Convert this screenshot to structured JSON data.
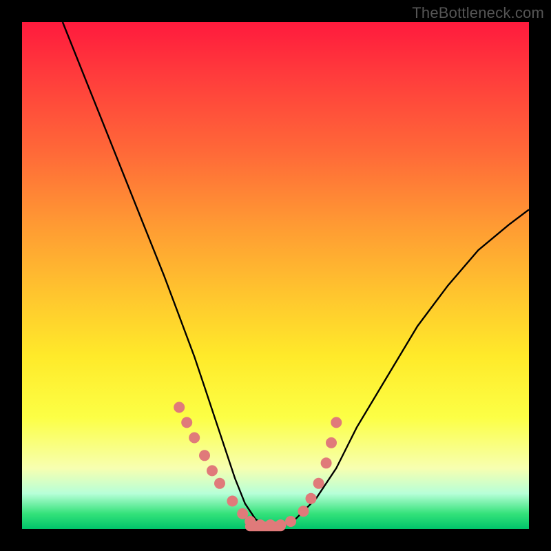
{
  "watermark": "TheBottleneck.com",
  "chart_data": {
    "type": "line",
    "title": "",
    "xlabel": "",
    "ylabel": "",
    "xlim": [
      0,
      100
    ],
    "ylim": [
      0,
      100
    ],
    "grid": false,
    "legend": false,
    "series": [
      {
        "name": "bottleneck-curve",
        "color": "#000000",
        "x": [
          8,
          12,
          16,
          20,
          24,
          28,
          31,
          34,
          36,
          38,
          40,
          42,
          44,
          46,
          48,
          51,
          54,
          58,
          62,
          66,
          72,
          78,
          84,
          90,
          96,
          100
        ],
        "y": [
          100,
          90,
          80,
          70,
          60,
          50,
          42,
          34,
          28,
          22,
          16,
          10,
          5,
          2,
          0.5,
          0.5,
          2,
          6,
          12,
          20,
          30,
          40,
          48,
          55,
          60,
          63
        ]
      },
      {
        "name": "marker-dots",
        "color": "#e07a7a",
        "type": "scatter",
        "x": [
          31.0,
          32.5,
          34.0,
          36.0,
          37.5,
          39.0,
          41.5,
          43.5,
          45.0,
          47.0,
          49.0,
          51.0,
          53.0,
          55.5,
          57.0,
          58.5,
          60.0,
          61.0,
          62.0
        ],
        "y": [
          24.0,
          21.0,
          18.0,
          14.5,
          11.5,
          9.0,
          5.5,
          3.0,
          1.5,
          0.8,
          0.8,
          0.8,
          1.5,
          3.5,
          6.0,
          9.0,
          13.0,
          17.0,
          21.0
        ]
      },
      {
        "name": "flat-bottom-band",
        "color": "#e07a7a",
        "type": "area",
        "x": [
          44,
          52
        ],
        "y": [
          0.5,
          0.5
        ]
      }
    ],
    "annotations": []
  }
}
